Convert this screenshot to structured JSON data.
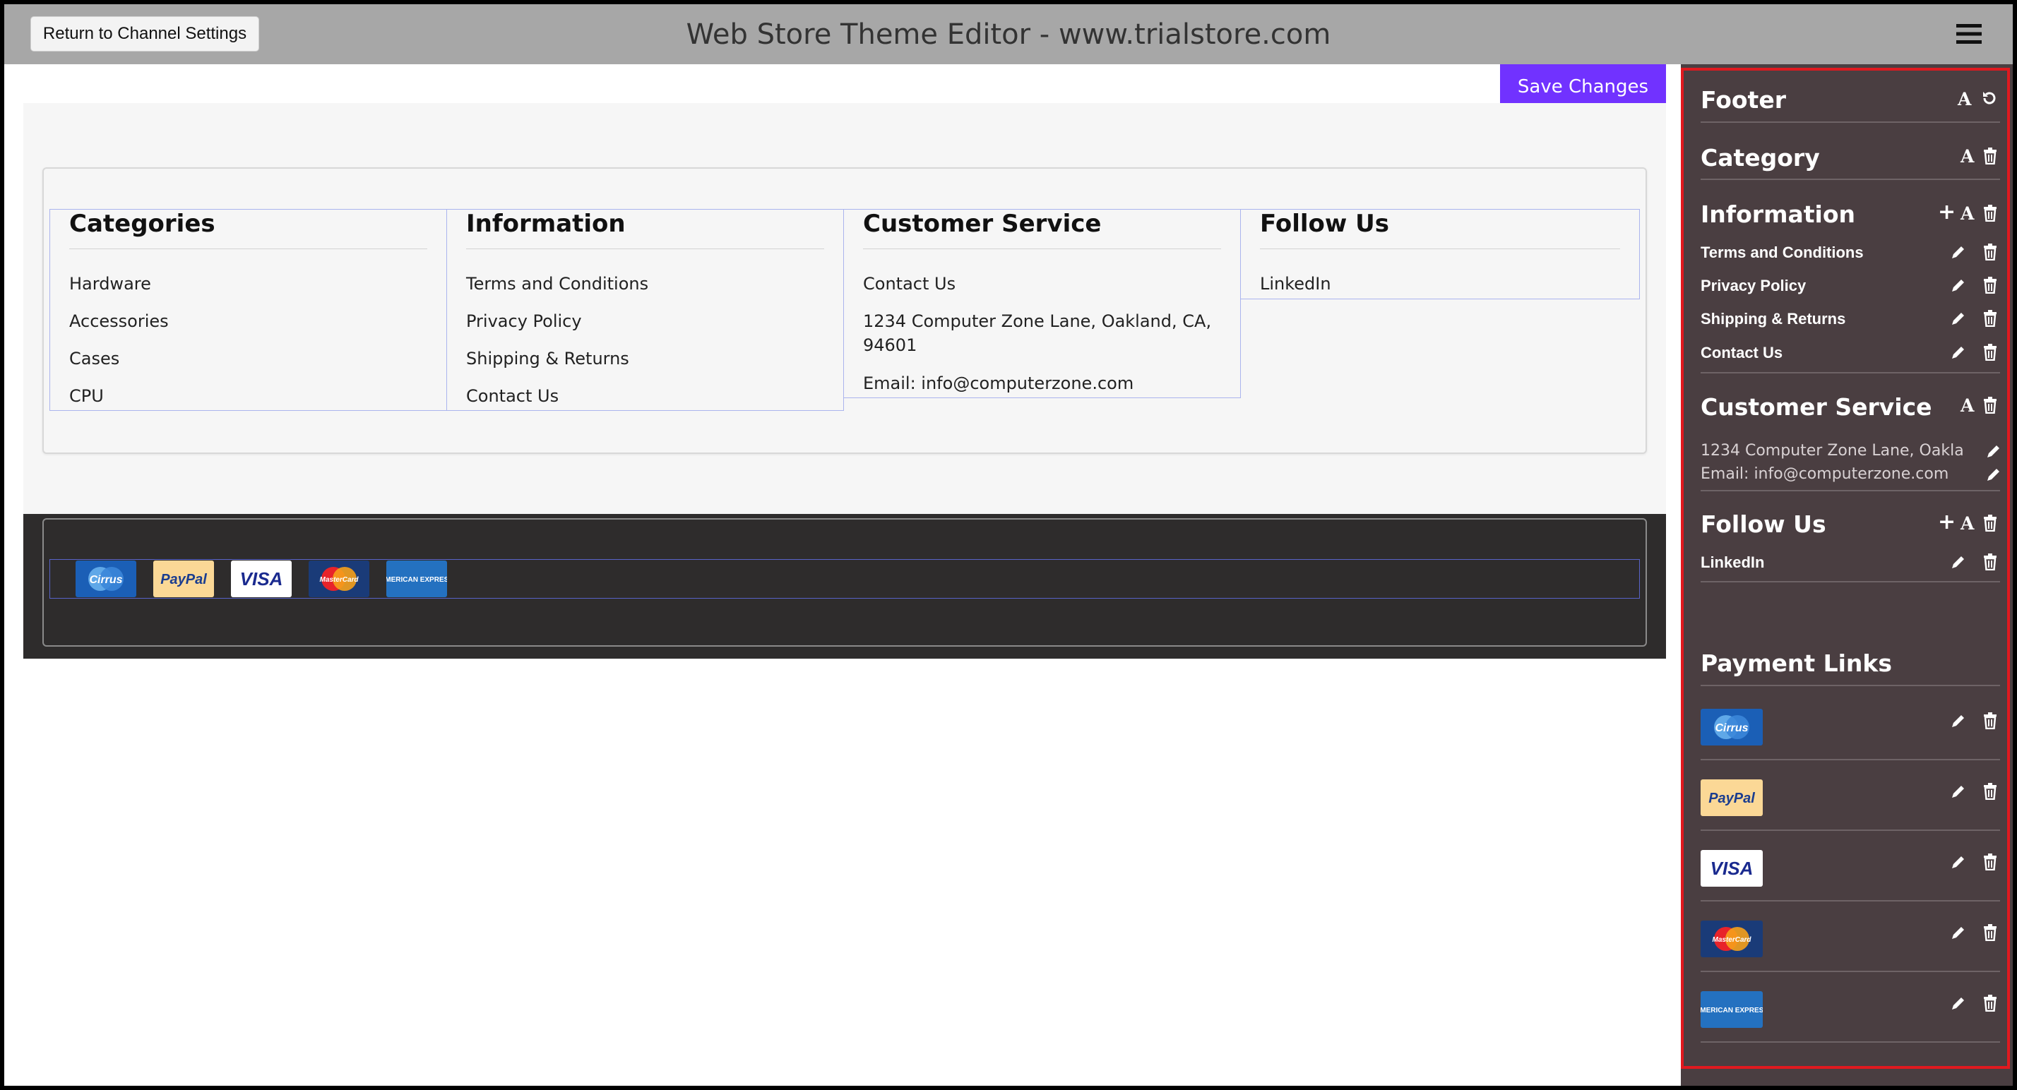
{
  "topbar": {
    "return_label": "Return to Channel Settings",
    "title": "Web Store Theme Editor - www.trialstore.com"
  },
  "toolbar": {
    "save_label": "Save Changes"
  },
  "preview": {
    "columns": [
      {
        "title": "Categories",
        "items": [
          "Hardware",
          "Accessories",
          "Cases",
          "CPU"
        ]
      },
      {
        "title": "Information",
        "items": [
          "Terms and Conditions",
          "Privacy Policy",
          "Shipping & Returns",
          "Contact Us"
        ]
      },
      {
        "title": "Customer Service",
        "items": [
          "Contact Us",
          "1234 Computer Zone Lane, Oakland, CA, 94601",
          "Email: info@computerzone.com"
        ]
      },
      {
        "title": "Follow Us",
        "items": [
          "LinkedIn"
        ]
      }
    ],
    "payments": [
      {
        "label": "Cirrus",
        "bg": "#1b5fb6",
        "fg": "#ffffff"
      },
      {
        "label": "PayPal",
        "bg": "#fbd896",
        "fg": "#1b3d8f"
      },
      {
        "label": "VISA",
        "bg": "#ffffff",
        "fg": "#1a2a8f"
      },
      {
        "label": "MasterCard",
        "bg": "#1a3b78",
        "fg": "#ffffff"
      },
      {
        "label": "AMERICAN EXPRESS",
        "bg": "#2471c0",
        "fg": "#ffffff"
      }
    ]
  },
  "sidebar": {
    "footer_title": "Footer",
    "category_title": "Category",
    "information_title": "Information",
    "information_items": [
      "Terms and Conditions",
      "Privacy Policy",
      "Shipping & Returns",
      "Contact Us"
    ],
    "customer_service_title": "Customer Service",
    "customer_service_address": "1234 Computer Zone Lane, Oakla",
    "customer_service_email": "Email: info@computerzone.com",
    "follow_title": "Follow Us",
    "follow_items": [
      "LinkedIn"
    ],
    "payment_title": "Payment Links",
    "font_glyph": "A",
    "plus_glyph": "+"
  },
  "colors": {
    "topbar": "#a7a7a7",
    "accent": "#7132ff",
    "sidebar": "#4a3e41",
    "highlight": "#e0191f",
    "dark_footer": "#2e2c2c"
  }
}
